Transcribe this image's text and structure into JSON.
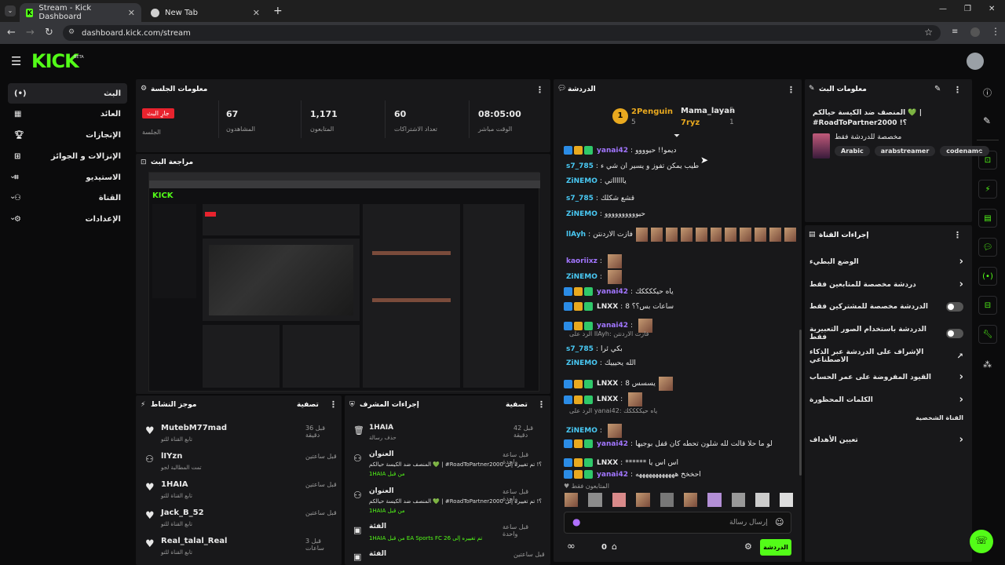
{
  "browser": {
    "tabs": [
      {
        "title": "Stream - Kick Dashboard",
        "active": true
      },
      {
        "title": "New Tab",
        "active": false
      }
    ],
    "url": "dashboard.kick.com/stream"
  },
  "brand": {
    "logo": "KICK",
    "beta": "BETA",
    "accent": "#53fc18"
  },
  "sidebar": {
    "items": [
      {
        "label": "البث",
        "icon": "broadcast-icon"
      },
      {
        "label": "العائد",
        "icon": "dashboard-icon"
      },
      {
        "label": "الإنجازات",
        "icon": "trophy-icon"
      },
      {
        "label": "الإنزالات و الجوائز",
        "icon": "gift-icon"
      },
      {
        "label": "الاستيديو",
        "icon": "studio-icon"
      },
      {
        "label": "القناة",
        "icon": "people-icon"
      },
      {
        "label": "الإعدادات",
        "icon": "gear-icon"
      }
    ]
  },
  "session": {
    "title": "معلومات الجلسة",
    "live_badge": "جارِ البث",
    "live_label": "الجلسة",
    "stats": [
      {
        "value": "67",
        "label": "المشاهدون"
      },
      {
        "value": "1,171",
        "label": "المتابعون"
      },
      {
        "value": "60",
        "label": "تعداد الاشتراكات"
      },
      {
        "value": "08:05:00",
        "label": "الوقت مباشر"
      }
    ]
  },
  "preview": {
    "title": "مراجعة البث"
  },
  "activity": {
    "title": "موجز النشاط",
    "filter": "تصفية",
    "items": [
      {
        "name": "MutebM77mad",
        "desc": "تابع القناة للتو",
        "time": "قبل 36 دقيقة"
      },
      {
        "name": "lIYzn",
        "desc": "تمت المطالبة لجو",
        "time": "قبل ساعتين"
      },
      {
        "name": "1HAIA",
        "desc": "تابع القناة للتو",
        "time": "قبل ساعتين"
      },
      {
        "name": "Jack_B_52",
        "desc": "تابع القناة للتو",
        "time": "قبل ساعتين"
      },
      {
        "name": "Real_talal_Real",
        "desc": "تابع القناة للتو",
        "time": "قبل 3 ساعات"
      }
    ]
  },
  "modactions": {
    "title": "إجراءات المشرف",
    "filter": "تصفية",
    "items": [
      {
        "name": "1HAIA",
        "desc": "حذف رسالة",
        "time": "قبل 42 دقيقة"
      },
      {
        "name": "العنوان",
        "desc": "المنصف ضد الكيسة حيالكم 💚 | #RoadToPartner؟! تم تغييره إلى 2000",
        "extra": "1HAIA من قبل",
        "time": "قبل ساعة واحدة"
      },
      {
        "name": "العنوان",
        "desc": "المنصف ضد الكيسة حيالكم 💚 | #RoadToPartner؟! تم تغييره إلى 2000",
        "extra": "1HAIA من قبل",
        "time": "قبل ساعة واحدة"
      },
      {
        "name": "الفئة",
        "desc": "1HAIA من قبل EA Sports FC 26 تم تغييره إلى",
        "time": "قبل ساعة واحدة"
      },
      {
        "name": "الفئة",
        "desc": "",
        "time": "قبل ساعتين"
      }
    ]
  },
  "chat": {
    "title": "الدردشة",
    "leaderboard": [
      {
        "rank": "1",
        "name": "2Penguin",
        "count": "5"
      },
      {
        "name": "Mama_layan",
        "count": "5"
      },
      {
        "name": "7ryz",
        "count": "1"
      }
    ],
    "messages": [
      {
        "user": "yanai42",
        "text": "ديمو!! حيوووو",
        "color": "#a276ff"
      },
      {
        "user": "s7_785",
        "text": "طيب يمكن تفوز و يسير ان شي ء",
        "color": "#49c9f4"
      },
      {
        "user": "ZiNEMO",
        "text": "يااااااتي",
        "color": "#49c9f4"
      },
      {
        "user": "s7_785",
        "text": "قشع شكلك",
        "color": "#49c9f4"
      },
      {
        "user": "ZiNEMO",
        "text": "حيوووووووووو",
        "color": "#49c9f4"
      },
      {
        "user": "llAyh",
        "text": "فازت الاردنتن",
        "color": "#49c9f4"
      },
      {
        "user": "kaoriixz",
        "text": "",
        "color": "#a276ff"
      },
      {
        "user": "ZiNEMO",
        "text": "",
        "color": "#49c9f4"
      },
      {
        "user": "yanai42",
        "text": "ياه حيككككك",
        "color": "#a276ff"
      },
      {
        "user": "LNXX",
        "text": "ساعات بس؟؟ 8",
        "color": "#e8e8e8"
      },
      {
        "user": "yanai42",
        "text": "",
        "color": "#a276ff"
      },
      {
        "user": "s7_785",
        "text": "بكي ئرا",
        "color": "#49c9f4"
      },
      {
        "user": "ZiNEMO",
        "text": "الله يحيييك",
        "color": "#49c9f4"
      },
      {
        "user": "LNXX",
        "text": "يسسس 8",
        "color": "#e8e8e8"
      },
      {
        "user": "LNXX",
        "text": "",
        "color": "#e8e8e8"
      },
      {
        "user": "ZiNEMO",
        "text": "",
        "color": "#49c9f4"
      },
      {
        "user": "yanai42",
        "text": "لو ما حلا قالت لله شلون تحطه كان قفل بوجيها",
        "color": "#a276ff"
      },
      {
        "user": "LNXX",
        "text": "****** اس اس يا",
        "color": "#e8e8e8"
      },
      {
        "user": "yanai42",
        "text": "احخخخ ههههههههههههه",
        "color": "#a276ff"
      }
    ],
    "reply1": "الرد على llAyh: فازت الاردنتن",
    "reply2": "الرد على yanai42: ياه حيككككك",
    "followers_only": "المتابعون فقط",
    "placeholder": "إرسال رسالة",
    "send": "الدردشة",
    "viewers": "0"
  },
  "streaminfo": {
    "title": "معلومات البث",
    "stream_title": "المنصف ضد الكيسة حيالكم 💚 | #RoadToPartner؟! 2000",
    "subtitle": "مخصصة للدردشة فقط",
    "tags": [
      "Arabic",
      "arabstreamer",
      "codename"
    ]
  },
  "channelactions": {
    "title": "إجراءات القناة",
    "items": [
      {
        "label": "الوضع البطيء",
        "type": "chevron"
      },
      {
        "label": "دردشة مخصصة للمتابعين فقط",
        "type": "chevron"
      },
      {
        "label": "الدردشة مخصصة للمشتركين فقط",
        "type": "toggle"
      },
      {
        "label": "الدردشة باستخدام الصور التعبيرية فقط",
        "type": "toggle"
      },
      {
        "label": "الإشراف على الدردشة عبر الذكاء الاصطناعي",
        "type": "external"
      },
      {
        "label": "القيود المفروضة على عمر الحساب",
        "type": "chevron"
      },
      {
        "label": "الكلمات المحظورة",
        "type": "chevron"
      },
      {
        "label": "القناة الشخصية",
        "type": "none"
      },
      {
        "label": "تعيين الأهداف",
        "type": "chevron"
      }
    ]
  }
}
